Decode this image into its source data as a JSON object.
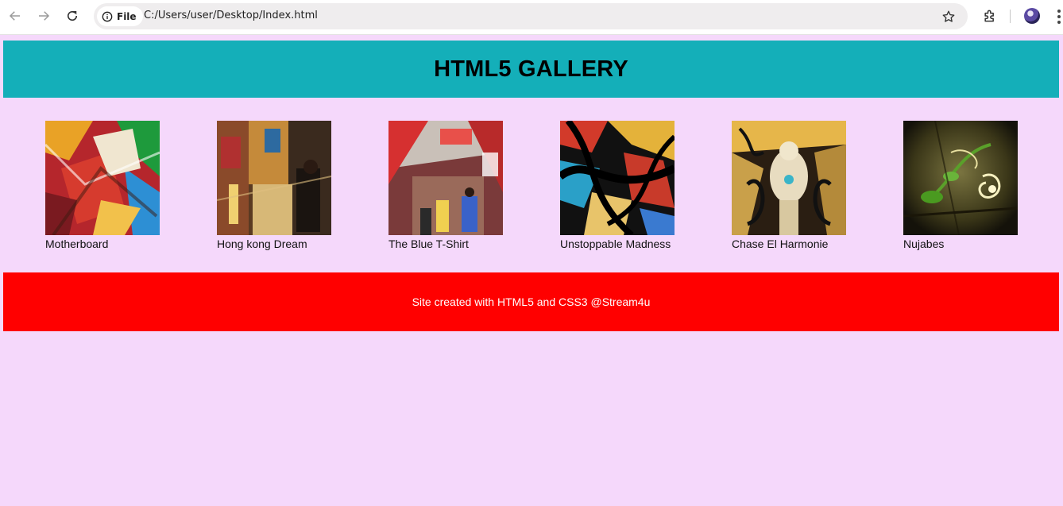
{
  "browser": {
    "site_chip_label": "File",
    "url": "C:/Users/user/Desktop/Index.html",
    "icons": [
      "back-arrow-icon",
      "forward-arrow-icon",
      "reload-icon",
      "info-icon",
      "star-icon",
      "extensions-puzzle-icon",
      "profile-avatar",
      "kebab-menu-icon"
    ]
  },
  "page": {
    "title": "HTML5 GALLERY",
    "gallery": [
      {
        "caption": "Motherboard"
      },
      {
        "caption": "Hong kong Dream"
      },
      {
        "caption": "The Blue T-Shirt"
      },
      {
        "caption": "Unstoppable Madness"
      },
      {
        "caption": "Chase El Harmonie"
      },
      {
        "caption": "Nujabes"
      }
    ],
    "footer": "Site created with HTML5 and CSS3 @Stream4u"
  },
  "colors": {
    "page_background": "#f5d8fb",
    "header_background": "#14afb9",
    "footer_background": "#ff0000",
    "footer_text": "#ffffff"
  }
}
